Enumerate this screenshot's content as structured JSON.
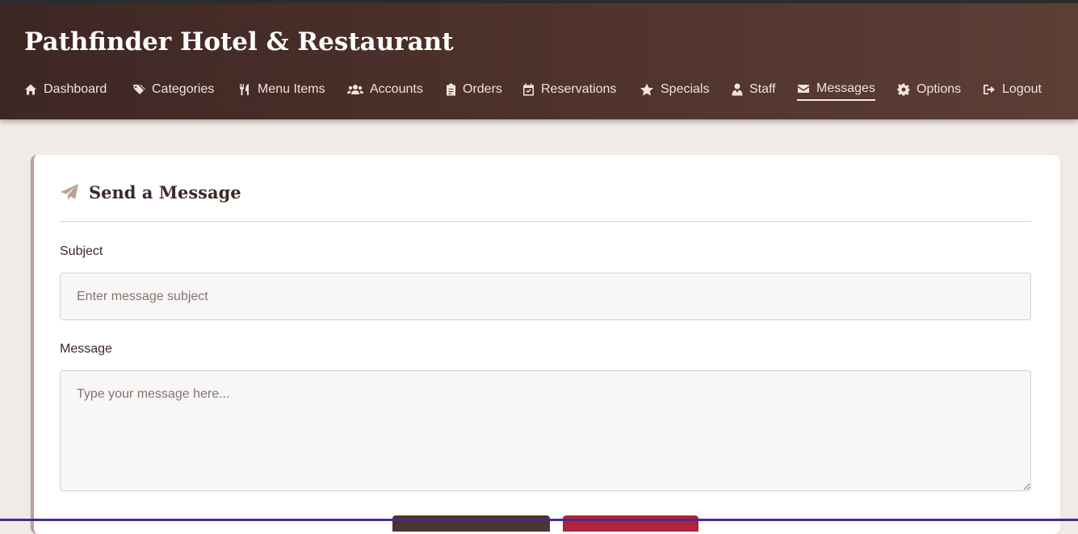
{
  "brand": {
    "title": "Pathfinder Hotel & Restaurant"
  },
  "nav": {
    "items": [
      {
        "label": "Dashboard",
        "icon": "home-icon"
      },
      {
        "label": "Categories",
        "icon": "tags-icon"
      },
      {
        "label": "Menu Items",
        "icon": "utensils-icon"
      },
      {
        "label": "Accounts",
        "icon": "users-icon"
      },
      {
        "label": "Orders",
        "icon": "clipboard-icon"
      },
      {
        "label": "Reservations",
        "icon": "calendar-check-icon"
      },
      {
        "label": "Specials",
        "icon": "star-icon"
      },
      {
        "label": "Staff",
        "icon": "user-tie-icon"
      },
      {
        "label": "Messages",
        "icon": "envelope-icon",
        "active": true
      },
      {
        "label": "Options",
        "icon": "gear-icon"
      },
      {
        "label": "Logout",
        "icon": "sign-out-icon"
      }
    ]
  },
  "form": {
    "title": "Send a Message",
    "title_icon": "paper-plane-icon",
    "subject_label": "Subject",
    "subject_placeholder": "Enter message subject",
    "subject_value": "",
    "message_label": "Message",
    "message_placeholder": "Type your message here...",
    "message_value": ""
  },
  "colors": {
    "header_start": "#3d2724",
    "header_end": "#5c3e35",
    "accent": "#bda198",
    "primary_button": "#4b3530",
    "danger_button": "#b1233a"
  }
}
